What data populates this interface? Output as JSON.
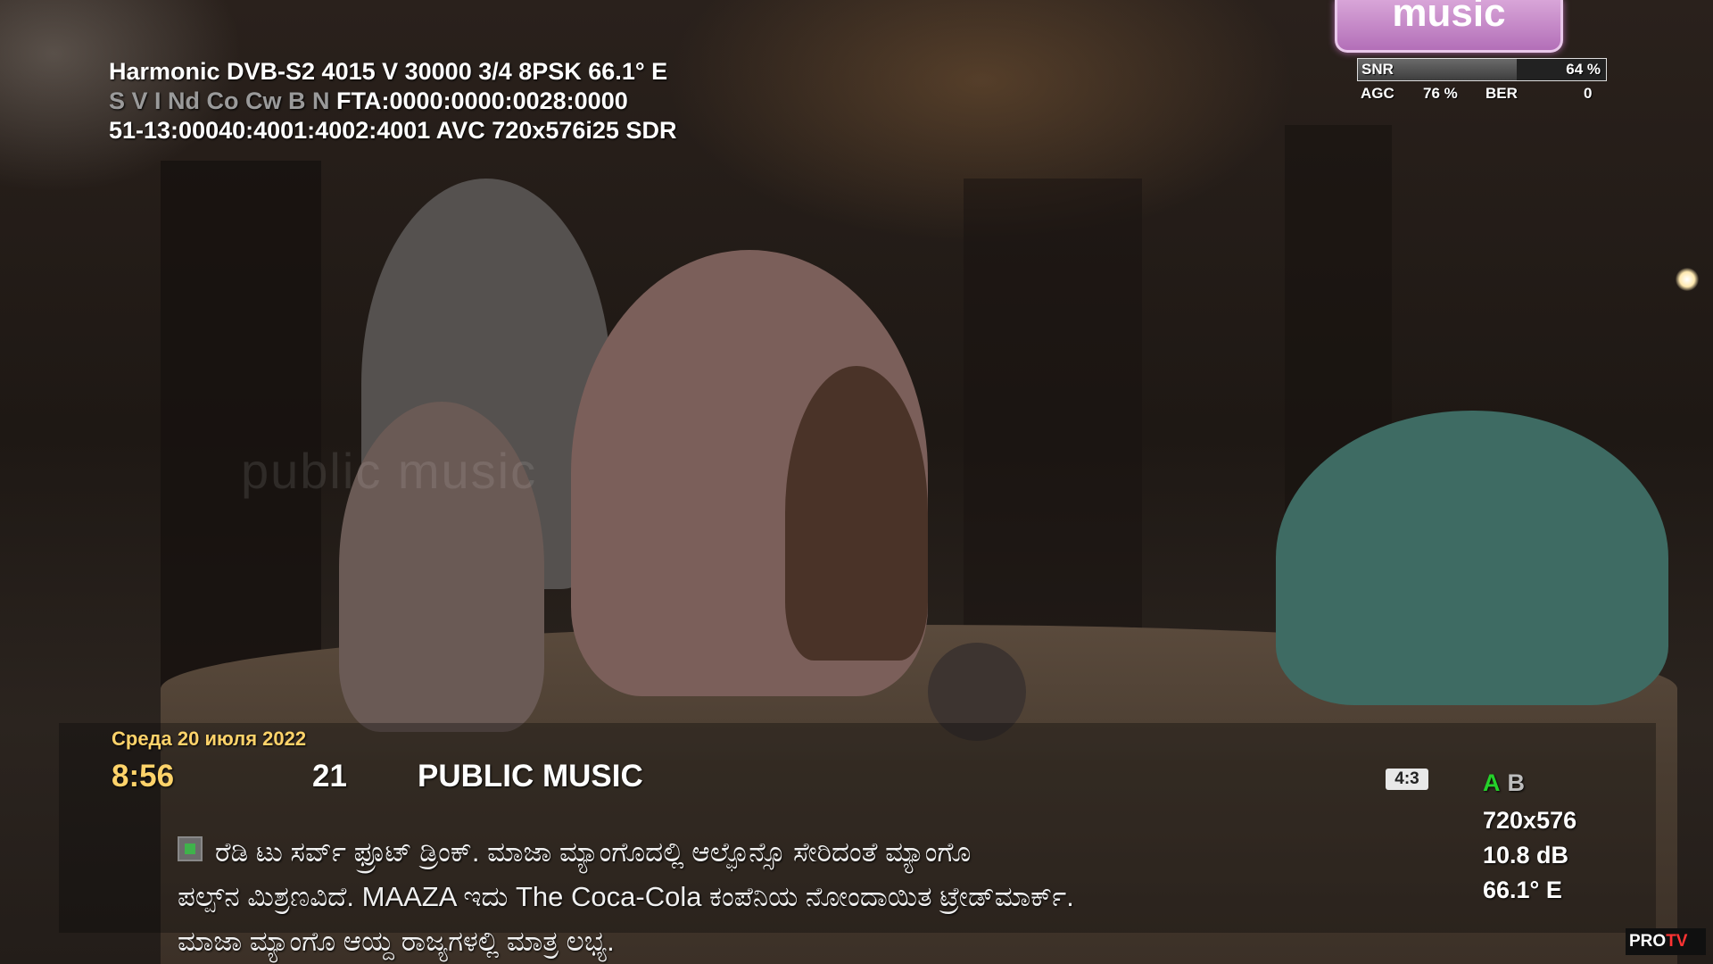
{
  "transponder": {
    "line1": "Harmonic DVB-S2 4015 V 30000 3/4 8PSK 66.1° E",
    "flags": "S V I Nd Co Cw B N",
    "ca_info": "FTA:0000:0000:0028:0000",
    "line3": "51-13:00040:4001:4002:4001 AVC 720x576i25 SDR"
  },
  "signal": {
    "snr_label": "SNR",
    "snr_value": "64 %",
    "snr_percent": 64,
    "agc_label": "AGC",
    "agc_value": "76 %",
    "ber_label": "BER",
    "ber_value": "0"
  },
  "channel_logo": "music",
  "watermark": "public music",
  "program": {
    "date": "Среда 20 июля 2022",
    "time": "8:56",
    "channel_number": "21",
    "channel_name": "PUBLIC MUSIC",
    "aspect": "4:3",
    "audio_a": "A",
    "audio_b": "B",
    "resolution": "720x576",
    "signal_db": "10.8 dB",
    "orbital": "66.1° E"
  },
  "subtitles": {
    "line1": "ರೆಡಿ ಟು ಸರ್ವ್ ಫ್ರೂಟ್ ಡ್ರಿಂಕ್. ಮಾಜಾ ಮ್ಯಾಂಗೊದಲ್ಲಿ ಆಲ್ಫೊನ್ಸೊ ಸೇರಿದಂತೆ ಮ್ಯಾಂಗೊ",
    "line2": "ಪಲ್ಪ್‌ನ ಮಿಶ್ರಣವಿದೆ. MAAZA ಇದು The Coca-Cola ಕಂಪೆನಿಯ ನೋಂದಾಯಿತ ಟ್ರೇಡ್‌ಮಾರ್ಕ್.",
    "line3": "ಮಾಜಾ ಮ್ಯಾಂಗೊ ಆಯ್ದ ರಾಜ್ಯಗಳಲ್ಲಿ ಮಾತ್ರ ಲಭ್ಯ."
  },
  "corner_logo": {
    "pro": "PRO",
    "tv": "TV"
  }
}
